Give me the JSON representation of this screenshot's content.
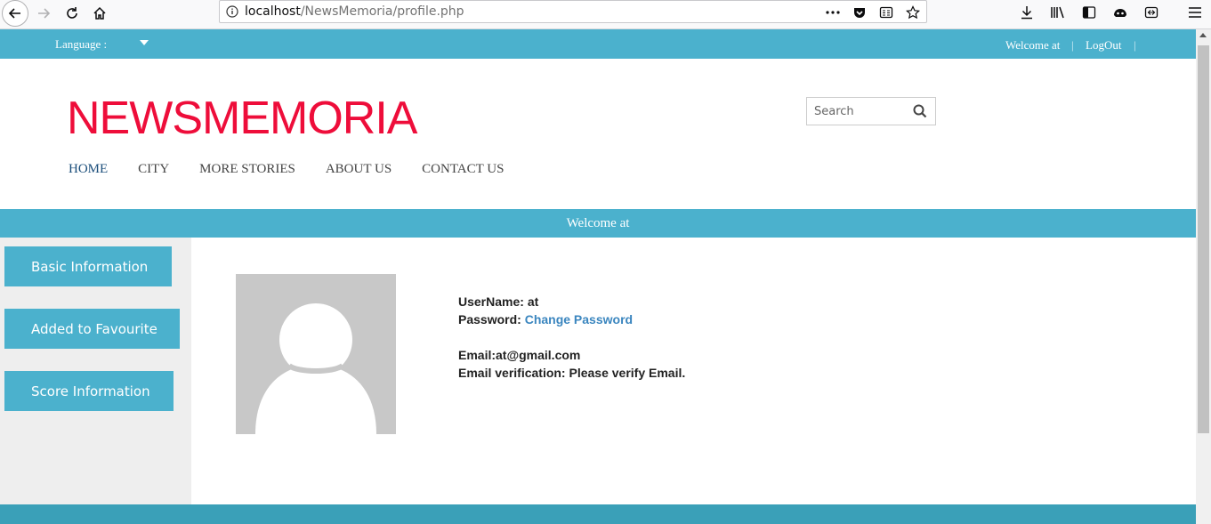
{
  "browser": {
    "url_host": "localhost",
    "url_path": "/NewsMemoria/profile.php"
  },
  "topbar": {
    "language_label": "Language :",
    "welcome": "Welcome at",
    "separator": "|",
    "logout": "LogOut"
  },
  "header": {
    "logo": "NEWSMEMORIA",
    "search_placeholder": "Search"
  },
  "nav": [
    {
      "label": "HOME",
      "active": true
    },
    {
      "label": "CITY"
    },
    {
      "label": "MORE STORIES"
    },
    {
      "label": "ABOUT US"
    },
    {
      "label": "CONTACT US"
    }
  ],
  "welcome_band": "Welcome at",
  "sidebar": {
    "items": [
      {
        "label": "Basic Information"
      },
      {
        "label": "Added to Favourite"
      },
      {
        "label": "Score Information"
      }
    ]
  },
  "profile": {
    "username_label": "UserName:",
    "username_value": "at",
    "password_label": "Password:",
    "password_link": "Change Password",
    "email_label": "Email:",
    "email_value": "at@gmail.com",
    "verification_label": "Email verification:",
    "verification_value": "Please verify Email."
  },
  "colors": {
    "accent": "#4bb1cd",
    "logo": "#ee0d3a",
    "link": "#3b86bf",
    "footer": "#3aa0b8"
  },
  "icons": [
    "back-arrow-icon",
    "forward-arrow-icon",
    "reload-icon",
    "home-icon",
    "info-icon",
    "more-icon",
    "pocket-icon",
    "reader-icon",
    "bookmark-star-icon",
    "download-icon",
    "library-icon",
    "sidebar-icon",
    "extension-icon",
    "screenshot-icon",
    "menu-icon",
    "search-icon",
    "caret-down-icon",
    "user-avatar-icon"
  ]
}
